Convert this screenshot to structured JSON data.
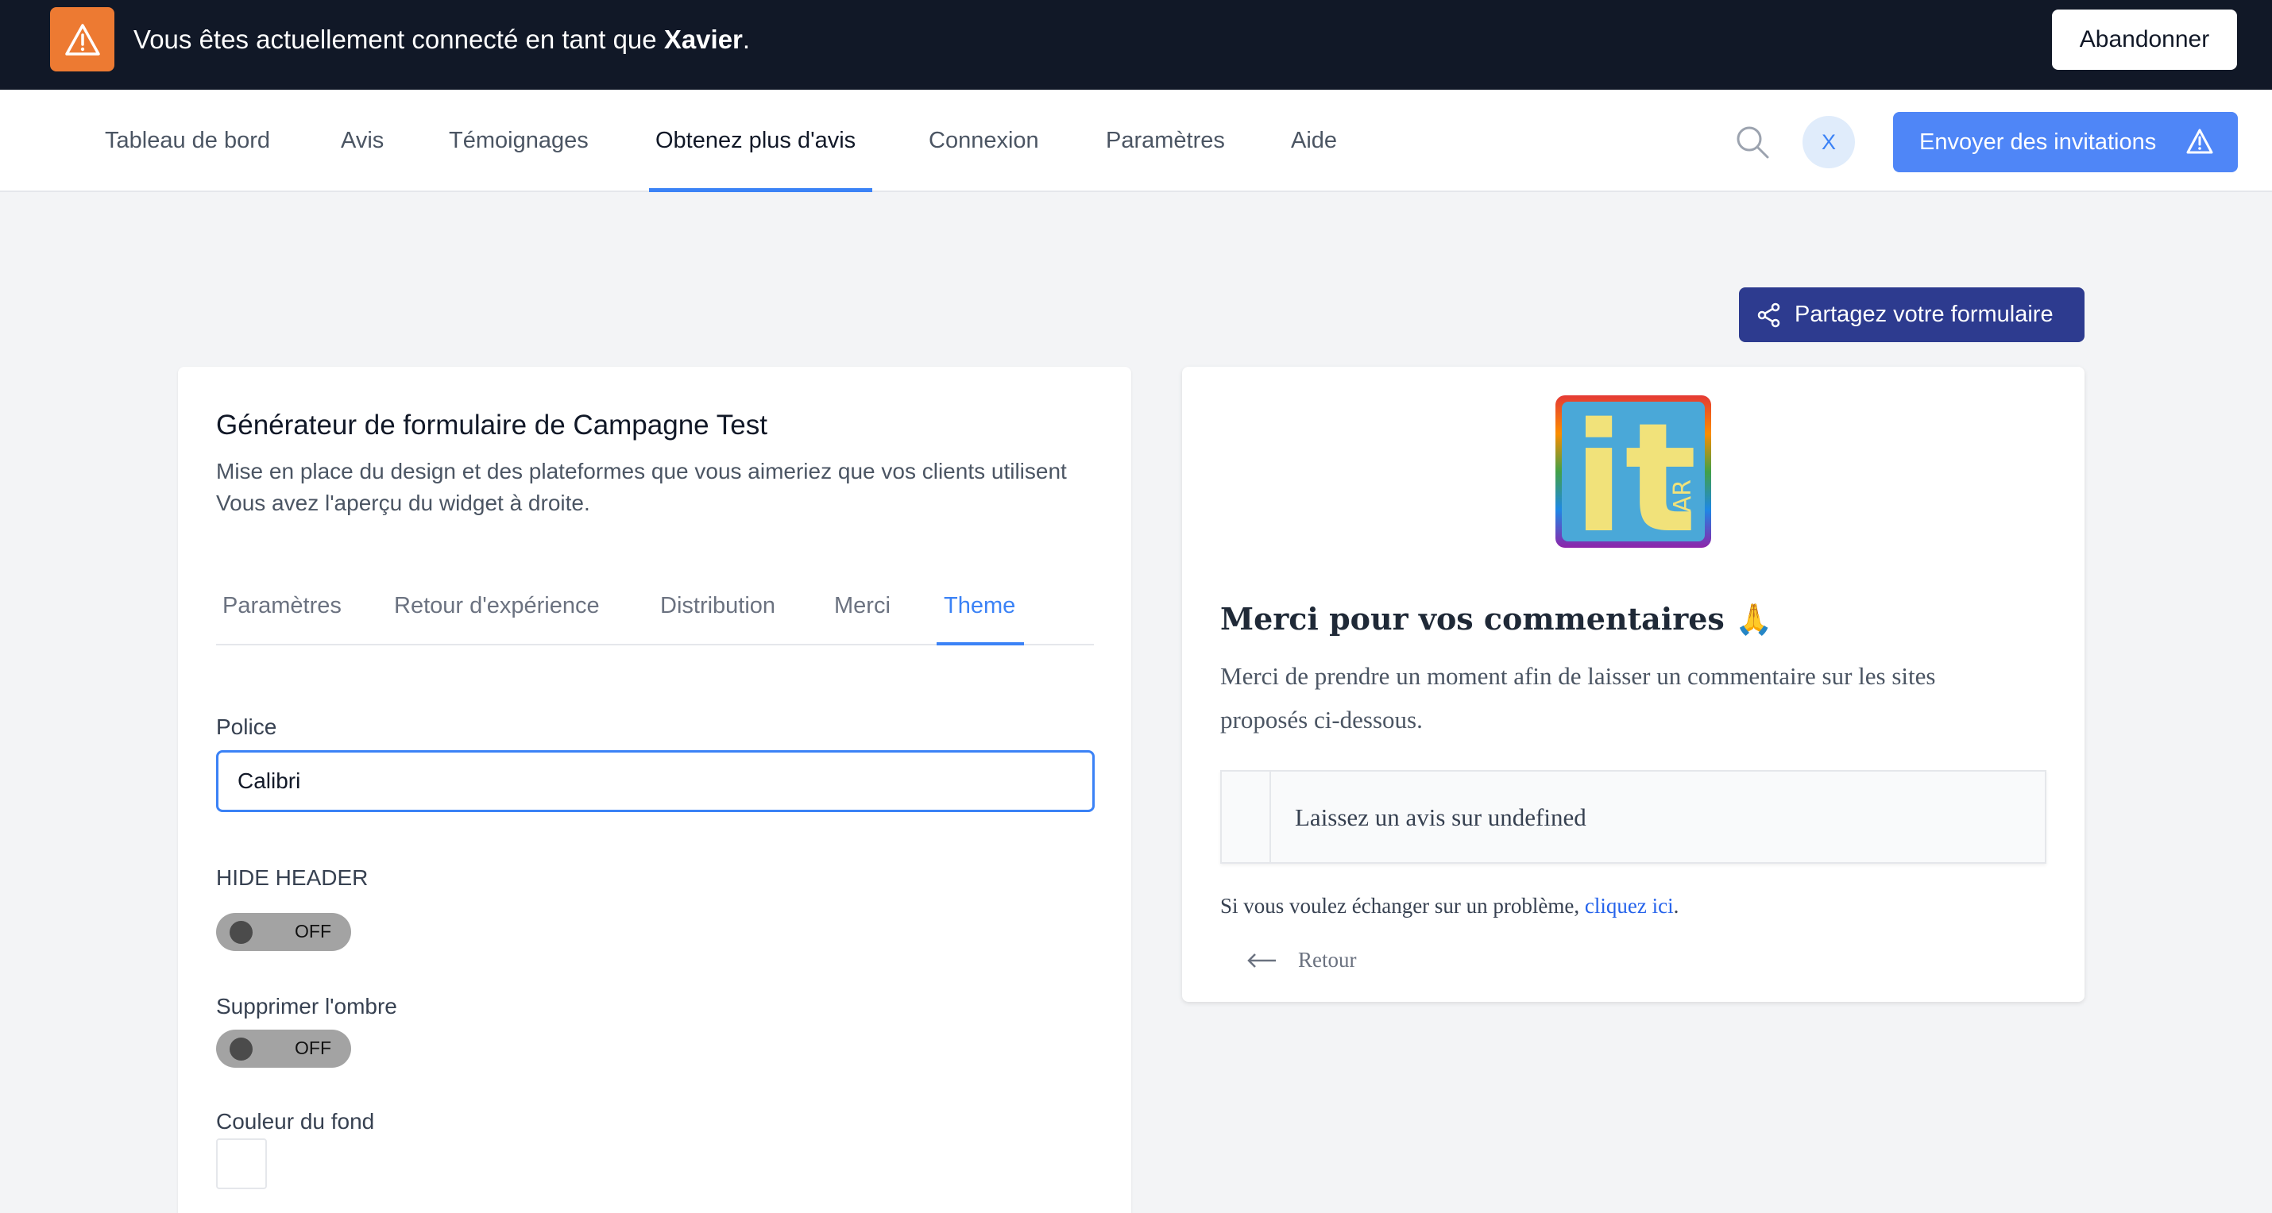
{
  "banner": {
    "prefix": "Vous êtes actuellement connecté en tant que ",
    "user": "Xavier",
    "suffix": ".",
    "abandon_label": "Abandonner",
    "icon": "warning-icon",
    "icon_color": "#ed7a32"
  },
  "nav": {
    "items": [
      {
        "label": "Tableau de bord"
      },
      {
        "label": "Avis"
      },
      {
        "label": "Témoignages"
      },
      {
        "label": "Obtenez plus d'avis"
      },
      {
        "label": "Connexion"
      },
      {
        "label": "Paramètres"
      },
      {
        "label": "Aide"
      }
    ],
    "active": "Obtenez plus d'avis",
    "avatar_initial": "X",
    "invite_label": "Envoyer des invitations",
    "accent": "#4f86f7"
  },
  "share": {
    "label": "Partagez votre formulaire",
    "color": "#2d3b8f"
  },
  "builder": {
    "title": "Générateur de formulaire de Campagne Test",
    "desc_line1": "Mise en place du design et des plateformes que vous aimeriez que vos clients utilisent",
    "desc_line2": "Vous avez l'aperçu du widget à droite.",
    "tabs": [
      {
        "label": "Paramètres"
      },
      {
        "label": "Retour d'expérience"
      },
      {
        "label": "Distribution"
      },
      {
        "label": "Merci"
      },
      {
        "label": "Theme"
      }
    ],
    "active_tab": "Theme",
    "font_label": "Police",
    "font_value": "Calibri",
    "hide_header_label": "HIDE HEADER",
    "hide_header_state": "OFF",
    "shadow_label": "Supprimer l'ombre",
    "shadow_state": "OFF",
    "bg_color_label": "Couleur du fond",
    "bg_color_value": "#ffffff"
  },
  "preview": {
    "logo_text": "it",
    "logo_sub": "BAR",
    "title": "Merci pour vos commentaires 🙏",
    "desc": "Merci de prendre un moment afin de laisser un commentaire sur les sites proposés ci-dessous.",
    "review_item": "Laissez un avis sur undefined",
    "problem_text": "Si vous voulez échanger sur un problème, ",
    "problem_link": "cliquez ici",
    "problem_end": ".",
    "back_label": "Retour"
  }
}
